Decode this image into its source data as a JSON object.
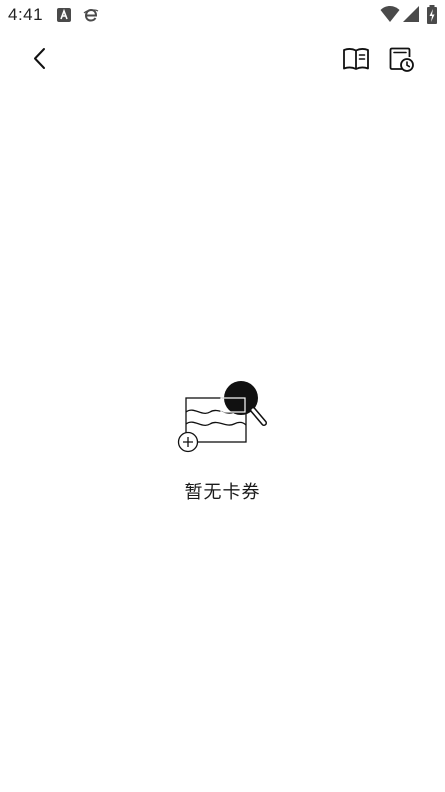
{
  "status_bar": {
    "time": "4:41",
    "notification_icons": [
      "a-letter-icon",
      "browser-e-icon"
    ],
    "right_icons": [
      "wifi-icon",
      "cell-signal-icon",
      "battery-charging-icon"
    ]
  },
  "app_bar": {
    "back_icon": "chevron-left-icon",
    "actions": [
      "book-icon",
      "history-clock-icon"
    ]
  },
  "empty_state": {
    "illustration": "card-search-illustration",
    "message": "暂无卡券"
  },
  "colors": {
    "background": "#ffffff",
    "foreground": "#111111"
  }
}
